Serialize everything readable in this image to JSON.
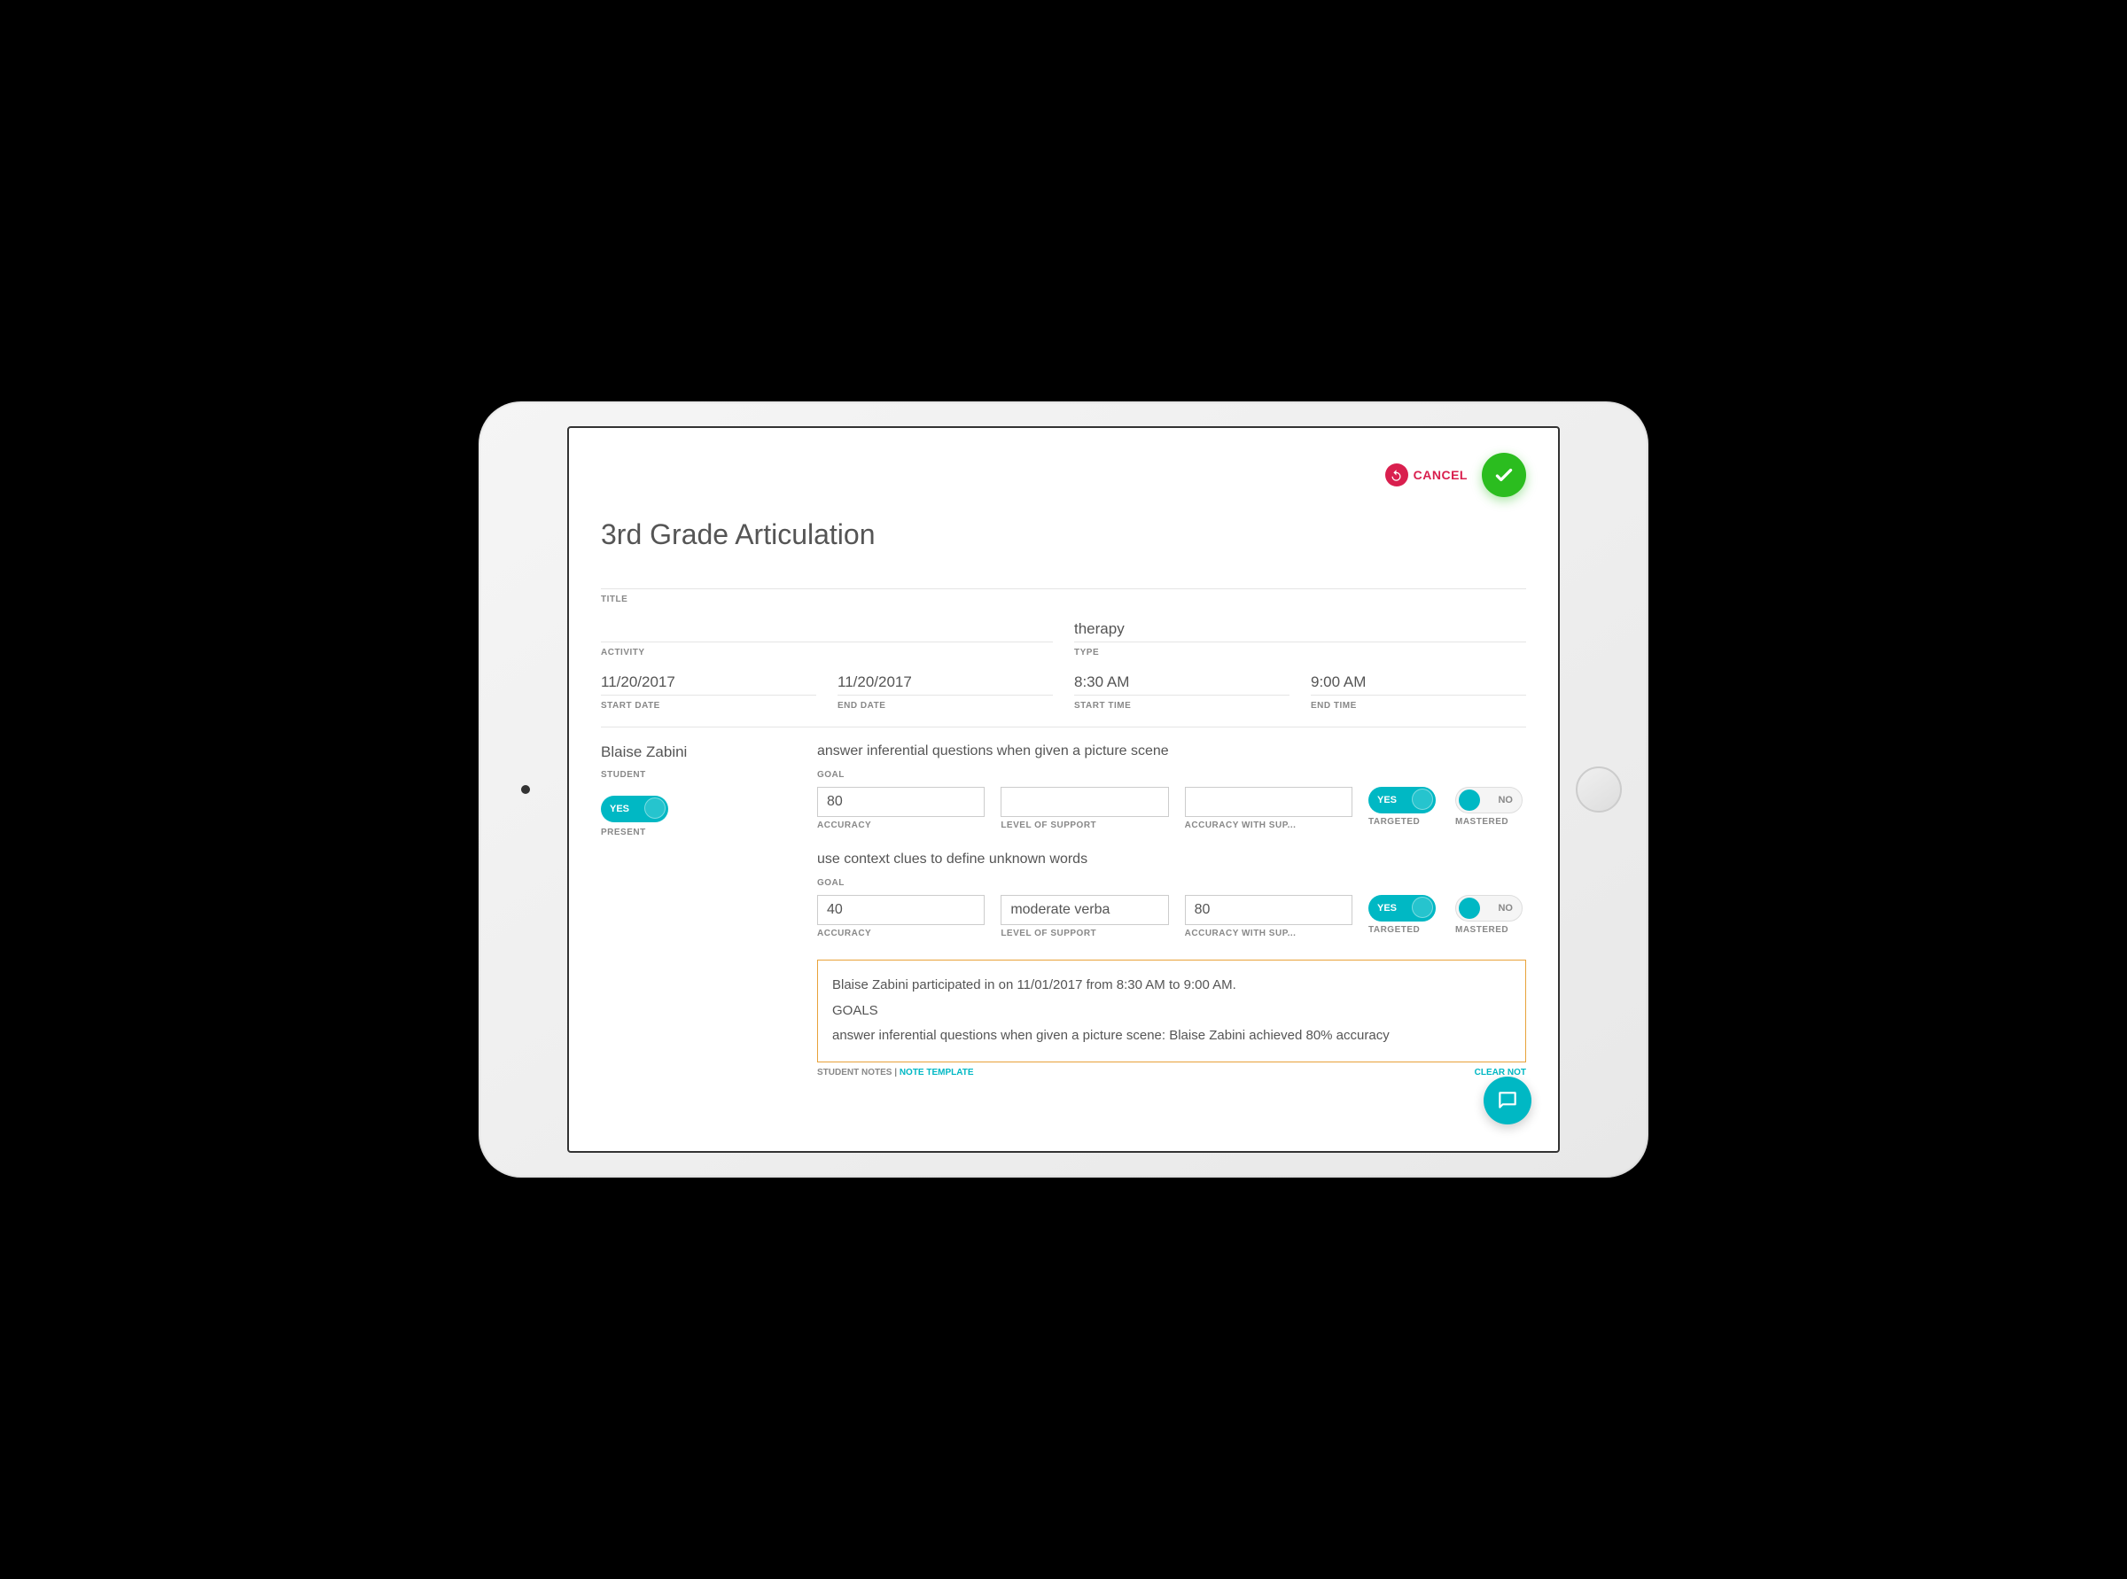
{
  "actions": {
    "cancel_label": "CANCEL"
  },
  "page": {
    "title": "3rd Grade Articulation"
  },
  "labels": {
    "title": "TITLE",
    "activity": "ACTIVITY",
    "type": "TYPE",
    "start_date": "START DATE",
    "end_date": "END DATE",
    "start_time": "START TIME",
    "end_time": "END TIME",
    "student": "STUDENT",
    "present": "PRESENT",
    "goal": "GOAL",
    "accuracy": "ACCURACY",
    "level_of_support": "LEVEL OF SUPPORT",
    "accuracy_with_support": "ACCURACY WITH SUP...",
    "targeted": "TARGETED",
    "mastered": "MASTERED",
    "student_notes": "STUDENT NOTES",
    "note_template": "NOTE TEMPLATE",
    "clear_notes": "CLEAR NOT",
    "yes": "YES",
    "no": "NO"
  },
  "fields": {
    "title_value": "",
    "activity_value": "",
    "type_value": "therapy",
    "start_date": "11/20/2017",
    "end_date": "11/20/2017",
    "start_time": "8:30 AM",
    "end_time": "9:00 AM"
  },
  "student": {
    "name": "Blaise Zabini",
    "present": "YES"
  },
  "goals": [
    {
      "title": "answer inferential questions when given a picture scene",
      "accuracy": "80",
      "level_of_support": "",
      "accuracy_with_support": "",
      "targeted": "YES",
      "mastered": "NO"
    },
    {
      "title": "use context clues to define unknown words",
      "accuracy": "40",
      "level_of_support": "moderate verba",
      "accuracy_with_support": "80",
      "targeted": "YES",
      "mastered": "NO"
    }
  ],
  "notes": {
    "line1": "Blaise Zabini participated in  on 11/01/2017 from 8:30 AM to 9:00 AM.",
    "line2": "GOALS",
    "line3": "answer inferential questions when given a picture scene: Blaise Zabini achieved 80% accuracy"
  }
}
